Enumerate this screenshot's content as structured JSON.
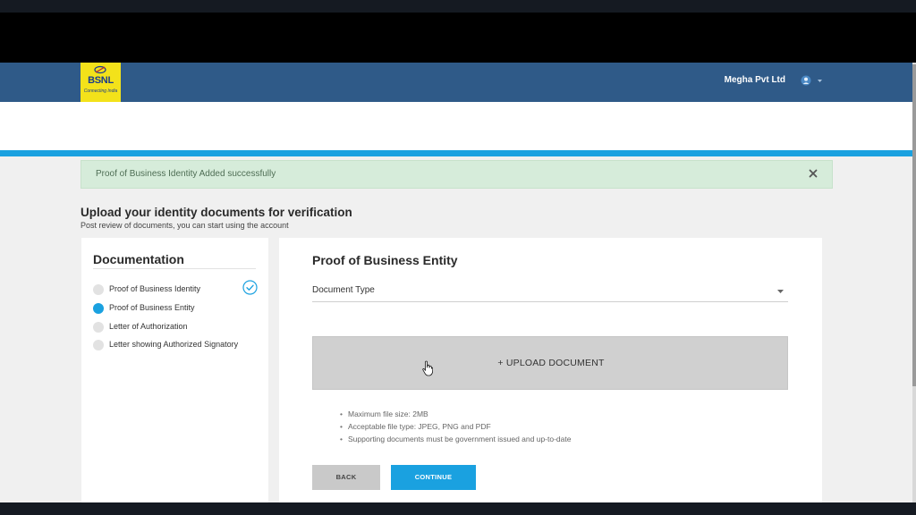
{
  "header": {
    "logo_text": "BSNL",
    "logo_tagline": "Connecting India",
    "company_name": "Megha Pvt Ltd",
    "user_icon": "user-circle-icon",
    "menu_icon": "caret-down-icon",
    "bar_color": "#2f5a88",
    "accent_color": "#1aa1e0"
  },
  "alert": {
    "message": "Proof of Business Identity Added successfully",
    "close_icon": "close-icon",
    "background": "#d6ecda"
  },
  "page": {
    "title": "Upload your identity documents for verification",
    "subtitle": "Post review of documents, you can start using the account"
  },
  "sidebar": {
    "title": "Documentation",
    "steps": [
      {
        "label": "Proof of Business Identity",
        "status": "completed"
      },
      {
        "label": "Proof of Business Entity",
        "status": "active"
      },
      {
        "label": "Letter of Authorization",
        "status": "pending"
      },
      {
        "label": "Letter showing Authorized Signatory",
        "status": "pending"
      }
    ]
  },
  "form": {
    "title": "Proof of Business Entity",
    "document_type_label": "Document Type",
    "upload_label": "+ UPLOAD DOCUMENT",
    "rules": [
      "Maximum file size: 2MB",
      "Acceptable file type: JPEG, PNG and PDF",
      "Supporting documents must be government issued and up-to-date"
    ],
    "back_label": "BACK",
    "continue_label": "CONTINUE"
  }
}
